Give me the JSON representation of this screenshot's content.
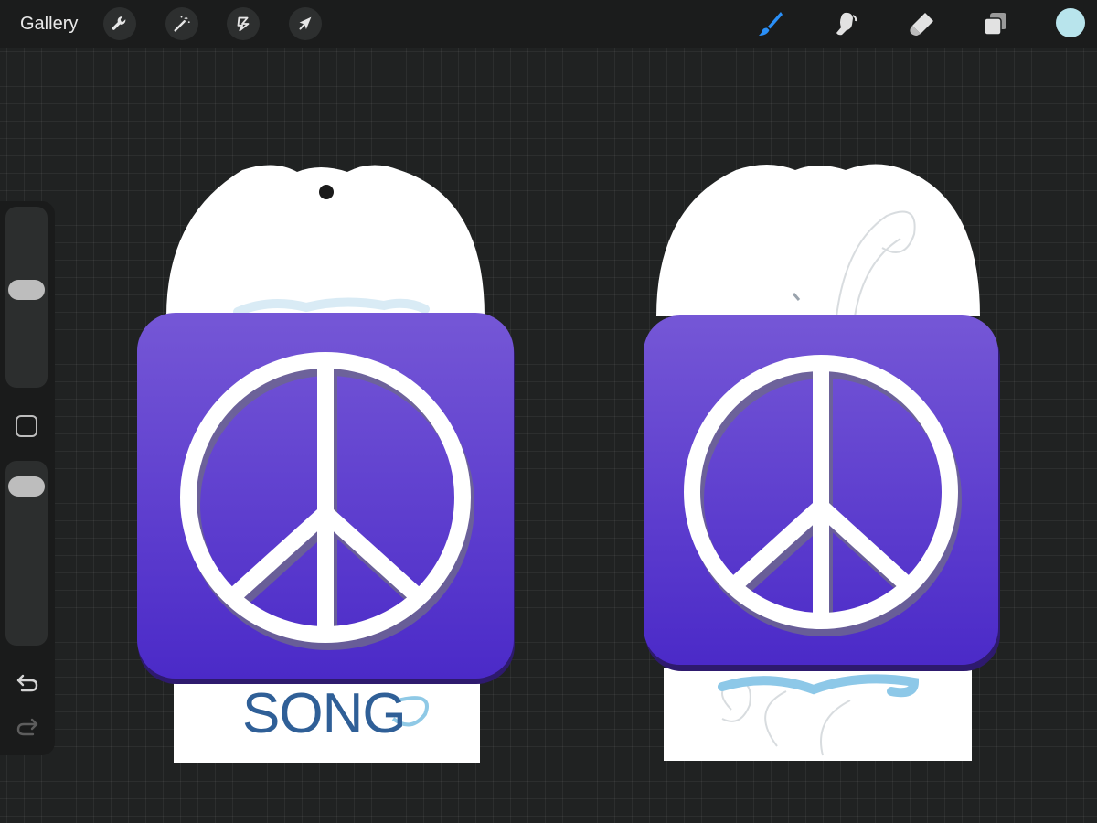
{
  "toolbar": {
    "gallery_label": "Gallery",
    "left_tools": [
      "wrench-icon",
      "magic-wand-icon",
      "selection-icon",
      "arrow-icon"
    ],
    "right_tools": [
      "brush-icon",
      "smudge-icon",
      "eraser-icon",
      "layers-icon"
    ],
    "active_tool": "brush-icon",
    "active_tool_color": "#2a8ff7",
    "current_color": "#b8e4ec"
  },
  "sidebar": {
    "brush_size_level": 0.55,
    "opacity_level": 0.92,
    "undo_icon": "undo-icon",
    "redo_icon": "redo-icon"
  },
  "artwork": {
    "left_card": {
      "text": "SONG",
      "text_color": "#2f5f97",
      "accent_color": "#8fc9e6"
    },
    "right_card": {
      "swirl_color": "#8dc8e8"
    },
    "icon_gradient_top": "#7557d6",
    "icon_gradient_bottom": "#4b2ac8",
    "symbol": "peace-sign-icon"
  }
}
